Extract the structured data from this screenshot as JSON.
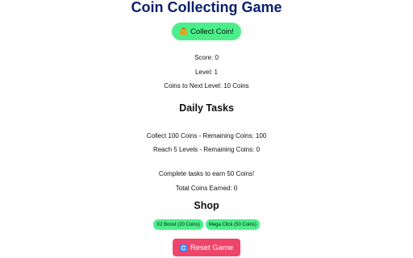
{
  "title": "Coin Collecting Game",
  "collect_button": {
    "icon": "money-bag-icon",
    "label": "Collect Coin!"
  },
  "stats": {
    "score": "Score: 0",
    "level": "Level: 1",
    "next_level": "Coins to Next Level: 10 Coins"
  },
  "daily_tasks": {
    "heading": "Daily Tasks",
    "tasks": [
      "Collect 100 Coins - Remaining Coins: 100",
      "Reach 5 Levels - Remaining Coins: 0"
    ],
    "reward_note": "Complete tasks to earn 50 Coins!",
    "total_earned": "Total Coins Earned: 0"
  },
  "shop": {
    "heading": "Shop",
    "items": [
      "X2 Boost (20 Coins)",
      "Mega Click (50 Coins)"
    ]
  },
  "reset_button": {
    "icon": "reset-arrows-icon",
    "label": "Reset Game"
  },
  "colors": {
    "title": "#0b1f6b",
    "accent_green": "#4bef8a",
    "reset_red": "#f0456a",
    "reset_icon_blue": "#3b82f6"
  }
}
